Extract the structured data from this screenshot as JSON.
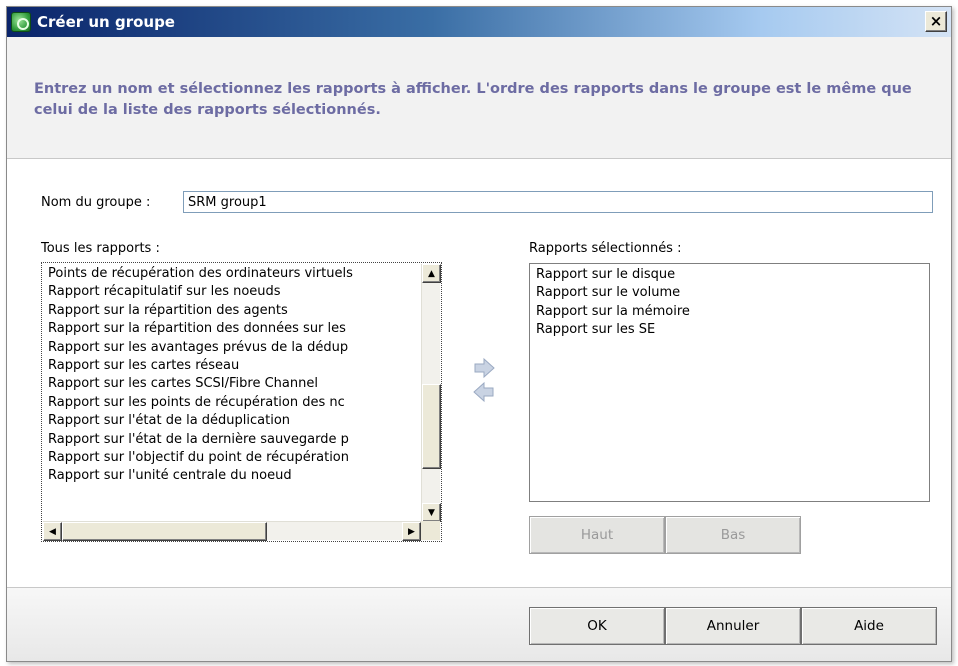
{
  "window": {
    "title": "Créer un groupe",
    "close_label": "×"
  },
  "instructions": "Entrez un nom et sélectionnez les rapports à afficher. L'ordre des rapports dans le groupe est le même que celui de la liste des rapports sélectionnés.",
  "group_name": {
    "label": "Nom du groupe :",
    "value": "SRM group1"
  },
  "all_reports": {
    "label": "Tous les rapports :",
    "items": [
      "Points de récupération des ordinateurs virtuels",
      "Rapport récapitulatif sur les noeuds",
      "Rapport sur la répartition des agents",
      "Rapport sur la répartition des données sur les",
      "Rapport sur les avantages prévus de la dédup",
      "Rapport sur les cartes réseau",
      "Rapport sur les cartes SCSI/Fibre Channel",
      "Rapport sur les points de récupération des nc",
      "Rapport sur l'état de la déduplication",
      "Rapport sur l'état de la dernière sauvegarde p",
      "Rapport sur l'objectif du point de récupération",
      "Rapport sur l'unité centrale du noeud"
    ]
  },
  "selected_reports": {
    "label": "Rapports sélectionnés :",
    "items": [
      "Rapport sur le disque",
      "Rapport sur le volume",
      "Rapport sur la mémoire",
      "Rapport sur les SE"
    ]
  },
  "order_buttons": {
    "up": "Haut",
    "down": "Bas"
  },
  "footer_buttons": {
    "ok": "OK",
    "cancel": "Annuler",
    "help": "Aide"
  },
  "colors": {
    "instruction_text": "#6d6ca3",
    "arrow": "#a8b6cc",
    "titlebar_start": "#0a246a",
    "titlebar_end": "#d4e3f5"
  },
  "icons": {
    "app": "green-gear-icon",
    "add": "arrow-right-icon",
    "remove": "arrow-left-icon"
  }
}
